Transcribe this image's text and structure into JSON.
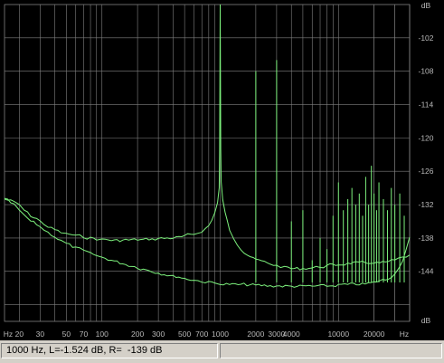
{
  "chart_data": {
    "type": "line",
    "x_scale": "log",
    "xlim": [
      15,
      40000
    ],
    "ylim": [
      -153,
      -96
    ],
    "x_tick_labels": [
      "Hz",
      "20",
      "30",
      "50",
      "70",
      "100",
      "200",
      "300",
      "500",
      "700",
      "1000",
      "2000",
      "3000",
      "4000",
      "10000",
      "20000",
      "Hz"
    ],
    "y_tick_labels": [
      "dB",
      "-102",
      "-108",
      "-114",
      "-120",
      "-126",
      "-132",
      "-138",
      "-144",
      "dB"
    ],
    "colors": {
      "grid": "#808080",
      "signal": "#7df27d",
      "background": "#000000",
      "axis_text": "#b8b8b8"
    },
    "series": [
      {
        "x": [
          15,
          18,
          20,
          22,
          25,
          28,
          30,
          35,
          40,
          45,
          50,
          60,
          70,
          80,
          90,
          100,
          120,
          150,
          200,
          250,
          300,
          400,
          500,
          600,
          700,
          800,
          850,
          900,
          950,
          980,
          990,
          1000,
          1010,
          1020,
          1050,
          1100,
          1150,
          1200,
          1300,
          1500,
          1700,
          1900,
          2000,
          2500,
          3000,
          3500,
          4000,
          5000,
          6000,
          7000,
          8000,
          10000,
          12000,
          15000,
          18000,
          20000,
          25000,
          30000,
          35000,
          40000
        ],
        "values": [
          -131,
          -131.5,
          -132,
          -133,
          -134,
          -134.5,
          -135,
          -136,
          -136.5,
          -137,
          -137.3,
          -137.6,
          -137.8,
          -138,
          -138.2,
          -138.3,
          -138.4,
          -138.4,
          -138.3,
          -138.2,
          -138.1,
          -138,
          -137.7,
          -137.3,
          -136.8,
          -135.8,
          -134.8,
          -133.5,
          -131.5,
          -129,
          -122,
          -96,
          -122,
          -128,
          -131,
          -133.5,
          -135,
          -136.5,
          -138,
          -140,
          -141,
          -141.5,
          -142,
          -142.5,
          -143,
          -143.3,
          -143.5,
          -143.5,
          -143.4,
          -143.2,
          -143,
          -142.8,
          -142.6,
          -142.5,
          -142.5,
          -142.4,
          -142.4,
          -142,
          -141.5,
          -141.2
        ]
      },
      {
        "x": [
          15,
          18,
          20,
          22,
          25,
          28,
          30,
          35,
          40,
          45,
          50,
          60,
          70,
          80,
          90,
          100,
          120,
          150,
          200,
          250,
          300,
          400,
          500,
          600,
          700,
          800,
          900,
          1000,
          1200,
          1500,
          2000,
          2500,
          3000,
          4000,
          5000,
          6000,
          8000,
          10000,
          12000,
          15000,
          20000,
          25000,
          30000,
          35000,
          40000
        ],
        "values": [
          -131,
          -132,
          -133,
          -134,
          -135,
          -135.5,
          -136,
          -137,
          -137.8,
          -138.5,
          -139,
          -139.8,
          -140.3,
          -140.8,
          -141.2,
          -141.5,
          -142,
          -142.6,
          -143.3,
          -143.8,
          -144.3,
          -144.9,
          -145.3,
          -145.6,
          -145.8,
          -146,
          -146.1,
          -146.2,
          -146.3,
          -146.4,
          -146.5,
          -146.6,
          -146.6,
          -146.7,
          -146.7,
          -146.7,
          -146.6,
          -146.5,
          -146.4,
          -146.3,
          -146,
          -145.5,
          -144.5,
          -142,
          -138
        ]
      }
    ],
    "harmonics": [
      {
        "x": 2000,
        "value": -108
      },
      {
        "x": 3000,
        "value": -106
      },
      {
        "x": 4000,
        "value": -135
      },
      {
        "x": 5000,
        "value": -133
      },
      {
        "x": 6000,
        "value": -142
      },
      {
        "x": 7000,
        "value": -138
      },
      {
        "x": 8000,
        "value": -140
      },
      {
        "x": 9000,
        "value": -134
      },
      {
        "x": 10000,
        "value": -128
      },
      {
        "x": 11000,
        "value": -133
      },
      {
        "x": 12000,
        "value": -131
      },
      {
        "x": 13000,
        "value": -129
      },
      {
        "x": 14000,
        "value": -132
      },
      {
        "x": 15000,
        "value": -130
      },
      {
        "x": 16000,
        "value": -134
      },
      {
        "x": 17000,
        "value": -127
      },
      {
        "x": 18000,
        "value": -132
      },
      {
        "x": 19000,
        "value": -125
      },
      {
        "x": 20000,
        "value": -130
      },
      {
        "x": 21000,
        "value": -133
      },
      {
        "x": 22000,
        "value": -128
      },
      {
        "x": 24000,
        "value": -131
      },
      {
        "x": 26000,
        "value": -133
      },
      {
        "x": 28000,
        "value": -129
      },
      {
        "x": 30000,
        "value": -132
      },
      {
        "x": 33000,
        "value": -130
      },
      {
        "x": 36000,
        "value": -134
      }
    ]
  },
  "status": {
    "readout": "1000 Hz, L=-1.524 dB, R=  -139 dB"
  }
}
